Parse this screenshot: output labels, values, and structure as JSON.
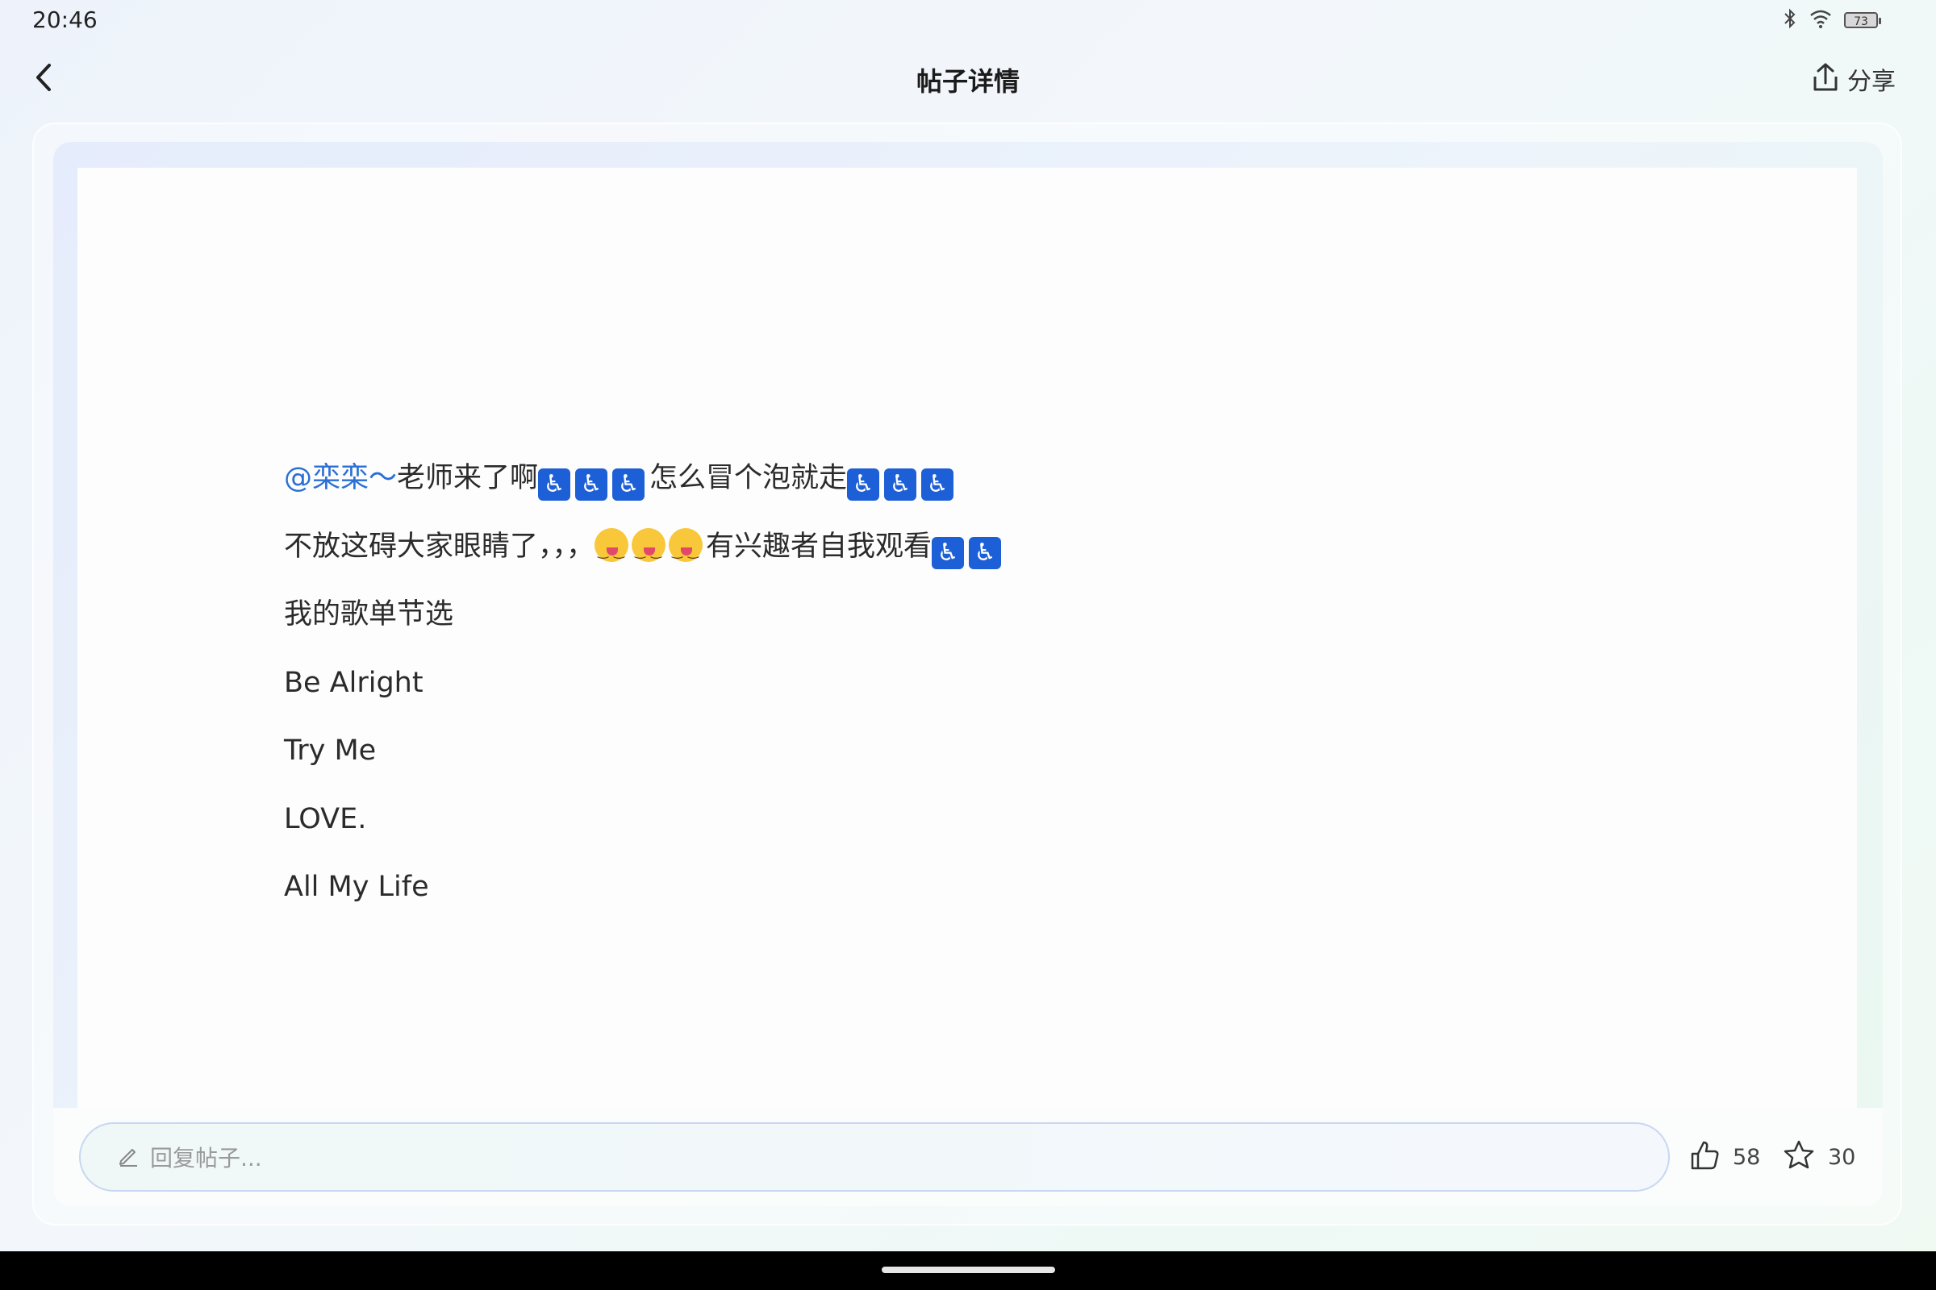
{
  "status_bar": {
    "time": "20:46",
    "battery_level": "73",
    "icons": [
      "bluetooth-icon",
      "wifi-icon",
      "battery-icon"
    ]
  },
  "header": {
    "title": "帖子详情",
    "share_label": "分享"
  },
  "post": {
    "mention": "@栾栾～",
    "line1_text_a": "老师来了啊",
    "line1_text_b": "怎么冒个泡就走",
    "line2_text_a": "不放这碍大家眼睛了，，，",
    "line2_text_b": "有兴趣者自我观看",
    "line3": "我的歌单节选",
    "songs": [
      "Be Alright",
      "Try Me",
      "LOVE.",
      "All My Life"
    ]
  },
  "bottom_bar": {
    "reply_placeholder": "回复帖子...",
    "like_count": "58",
    "favorite_count": "30"
  },
  "colors": {
    "mention": "#2a6fd4",
    "text": "#2b2b2b"
  }
}
